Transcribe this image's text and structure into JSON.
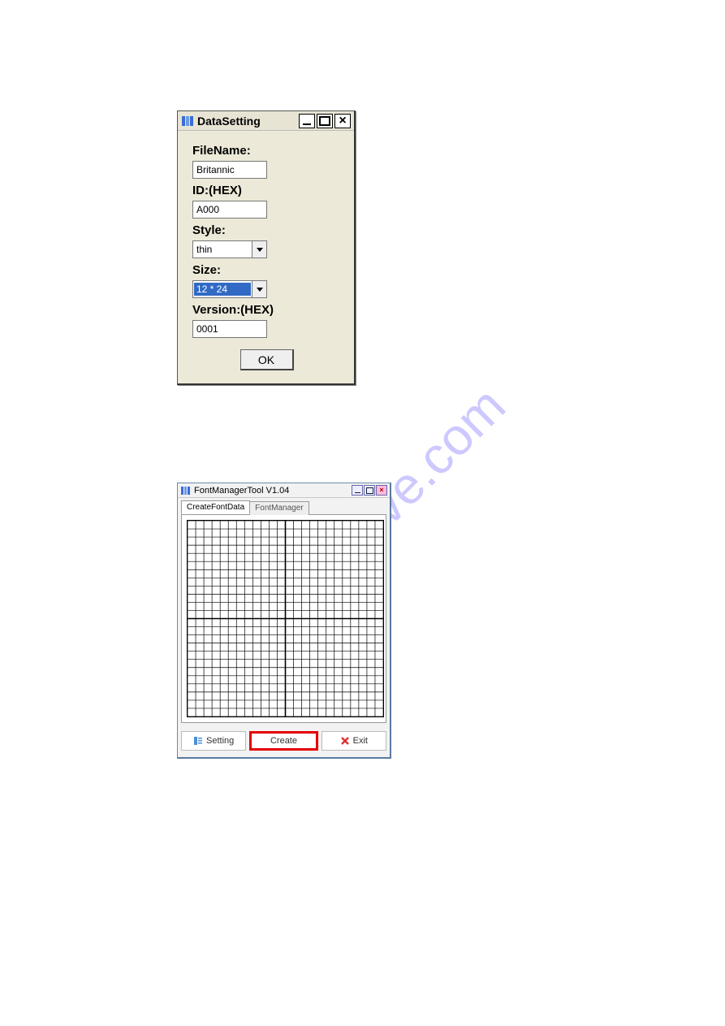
{
  "watermark_text": "manualshive.com",
  "datasetting": {
    "title": "DataSetting",
    "labels": {
      "filename": "FileName:",
      "id": "ID:(HEX)",
      "style": "Style:",
      "size": "Size:",
      "version": "Version:(HEX)"
    },
    "values": {
      "filename": "Britannic",
      "id": "A000",
      "style": "thin",
      "size": "12 * 24",
      "version": "0001"
    },
    "ok_label": "OK"
  },
  "fontmgr": {
    "title": "FontManagerTool V1.04",
    "tabs": {
      "create": "CreateFontData",
      "manager": "FontManager"
    },
    "buttons": {
      "setting": "Setting",
      "create": "Create",
      "exit": "Exit"
    },
    "grid": {
      "cols": 24,
      "rows": 24
    }
  }
}
